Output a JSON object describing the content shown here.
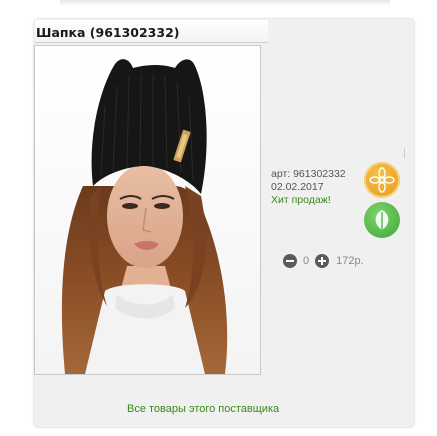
{
  "product": {
    "title": "Шапка (961302332)",
    "image_alt": "Шапка"
  },
  "info": {
    "sku": "арт: 961302332",
    "date": "02.02.2017",
    "hit": "Хит продаж!"
  },
  "cart": {
    "quantity": "0",
    "price": "172р."
  },
  "footer": {
    "supplier_link": "Все товары этого поставщика"
  },
  "colors": {
    "panel_bg": "#f0f0f0",
    "link_green": "#3a8a1a",
    "badge_orange": "#e8961a",
    "badge_green": "#3fa83a",
    "control_dark": "#5a5a5a"
  },
  "icons": {
    "badge_top": "flower-icon",
    "badge_bottom": "leaf-icon",
    "decrease": "minus-icon",
    "increase": "plus-icon"
  }
}
